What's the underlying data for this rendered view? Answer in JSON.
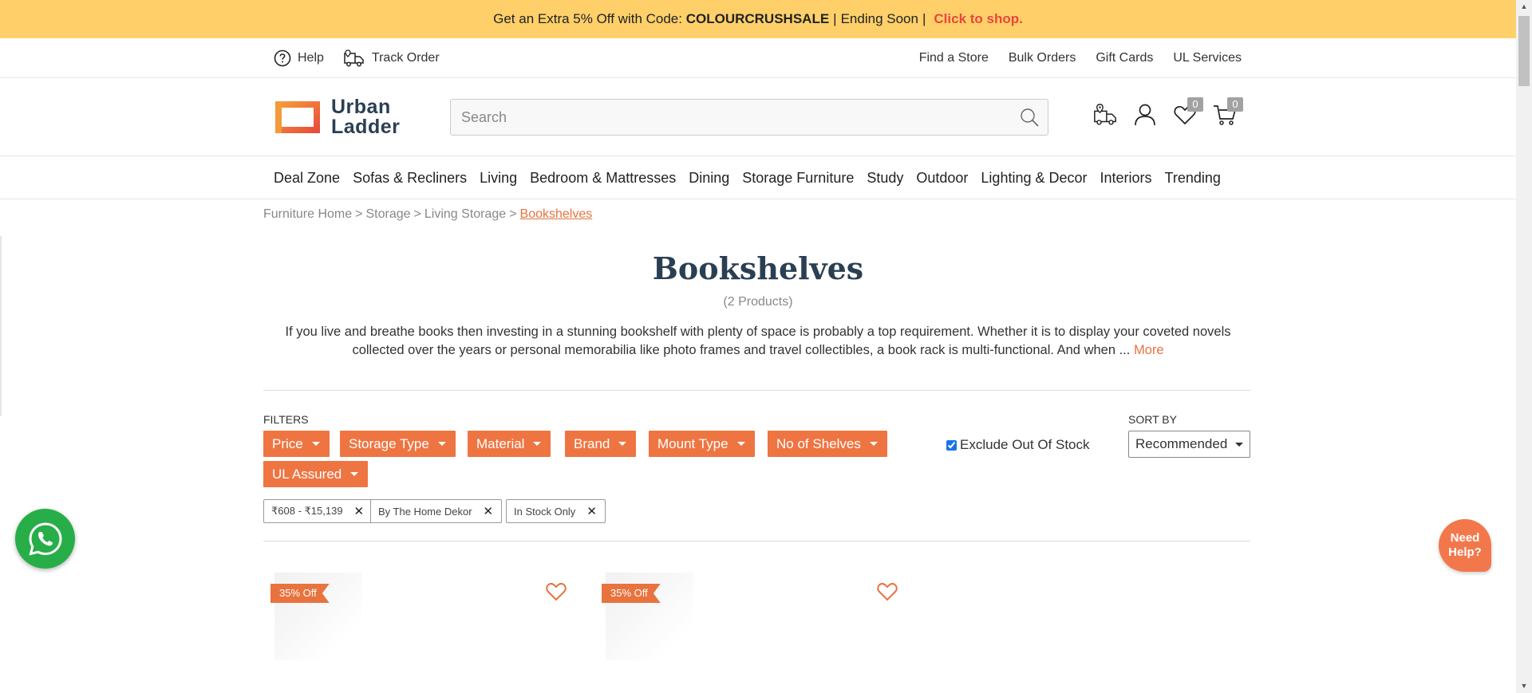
{
  "promo": {
    "lead": "Get an Extra 5% Off with Code:",
    "code": "COLOURCRUSHSALE",
    "separator": "|",
    "ending": "Ending Soon",
    "separator2": "|",
    "cta": "Click to shop."
  },
  "utility": {
    "left": [
      {
        "label": "Help",
        "icon": "help-icon"
      },
      {
        "label": "Track Order",
        "icon": "truck-icon"
      }
    ],
    "right": [
      "Find a Store",
      "Bulk Orders",
      "Gift Cards",
      "UL Services"
    ]
  },
  "header": {
    "logo_line1": "Urban",
    "logo_line2": "Ladder",
    "search_placeholder": "Search",
    "wishlist_count": "0",
    "cart_count": "0"
  },
  "nav": [
    "Deal Zone",
    "Sofas & Recliners",
    "Living",
    "Bedroom & Mattresses",
    "Dining",
    "Storage Furniture",
    "Study",
    "Outdoor",
    "Lighting & Decor",
    "Interiors",
    "Trending"
  ],
  "breadcrumb": [
    {
      "label": "Furniture Home"
    },
    {
      "label": "Storage"
    },
    {
      "label": "Living Storage"
    },
    {
      "label": "Bookshelves",
      "current": true
    }
  ],
  "page": {
    "title": "Bookshelves",
    "count": "(2 Products)",
    "description_line1": "If you live and breathe books then investing in a stunning bookshelf with plenty of space is probably a top requirement. Whether it is to display your coveted novels",
    "description_line2": "collected over the years or personal memorabilia like photo frames and travel collectibles, a book rack is multi-functional. And when ...",
    "more": "More"
  },
  "filters": {
    "label": "FILTERS",
    "buttons": [
      "Price",
      "Storage Type",
      "Material",
      "Brand",
      "Mount Type",
      "No of Shelves",
      "UL Assured"
    ],
    "exclude_oos_label": "Exclude Out Of Stock",
    "exclude_oos_checked": true,
    "active": [
      "₹608 - ₹15,139",
      "By The Home Dekor",
      "In Stock Only"
    ]
  },
  "sort": {
    "label": "SORT BY",
    "value": "Recommended"
  },
  "products": [
    {
      "discount": "35% Off"
    },
    {
      "discount": "35% Off"
    }
  ],
  "floating": {
    "help_line1": "Need",
    "help_line2": "Help?"
  },
  "colors": {
    "accent": "#ee7542",
    "promo_bg": "#ffd06a",
    "title": "#2b3f53",
    "whatsapp": "#27ae48"
  }
}
